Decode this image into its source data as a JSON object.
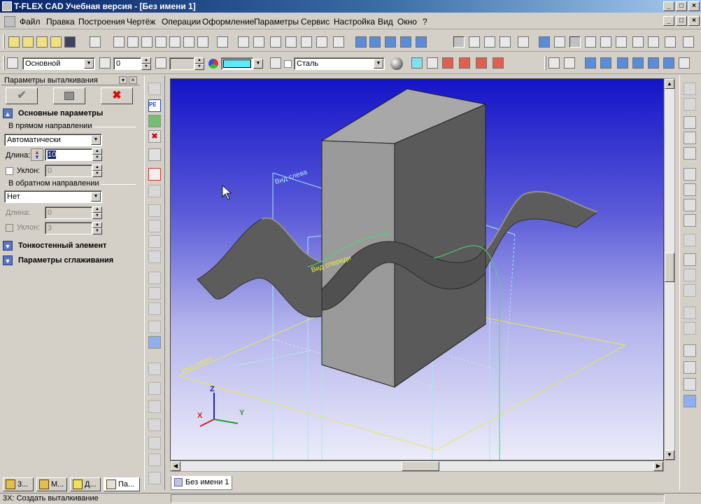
{
  "window": {
    "title": "T-FLEX CAD Учебная версия - [Без имени 1]",
    "controls": [
      "_",
      "□",
      "×"
    ],
    "mdi_controls": [
      "_",
      "□",
      "×"
    ]
  },
  "menu": {
    "items": [
      "Файл",
      "Правка",
      "Построения",
      "Чертёж",
      "Операции",
      "Оформление",
      "Параметры",
      "Сервис",
      "Настройка",
      "Вид",
      "Окно",
      "?"
    ]
  },
  "props_toolbar": {
    "layer": "Основной",
    "level": "0",
    "material": "Сталь"
  },
  "panel": {
    "title": "Параметры выталкивания",
    "ok_icon": "check-icon",
    "cancel_icon": "x-icon",
    "section_main": "Основные параметры",
    "forward_group": "В прямом направлении",
    "forward_mode": "Автоматически",
    "length_label": "Длина:",
    "length_value": "10",
    "slope_label": "Уклон:",
    "slope_value": "0",
    "reverse_group": "В обратном направлении",
    "reverse_mode": "Нет",
    "rev_length_label": "Длина:",
    "rev_length_value": "0",
    "rev_slope_label": "Уклон:",
    "rev_slope_value": "3",
    "section_thin": "Тонкостенный элемент",
    "section_smooth": "Параметры сглаживания"
  },
  "panel_tabs": [
    "3...",
    "М...",
    "Д...",
    "Па..."
  ],
  "viewport": {
    "plane_labels": [
      "Вид слева",
      "Вид спереди",
      "Вид сверху"
    ],
    "axes": {
      "x": "X",
      "y": "Y",
      "z": "Z"
    },
    "colors": {
      "bg_top": "#1414c8",
      "bg_bottom": "#ececfa",
      "body": "#6e6e6e",
      "plane": "#a8e8f0",
      "green": "#40e070",
      "yellow": "#e8e850"
    }
  },
  "doc_tab": "Без имени 1",
  "status": "3Х: Создать выталкивание"
}
